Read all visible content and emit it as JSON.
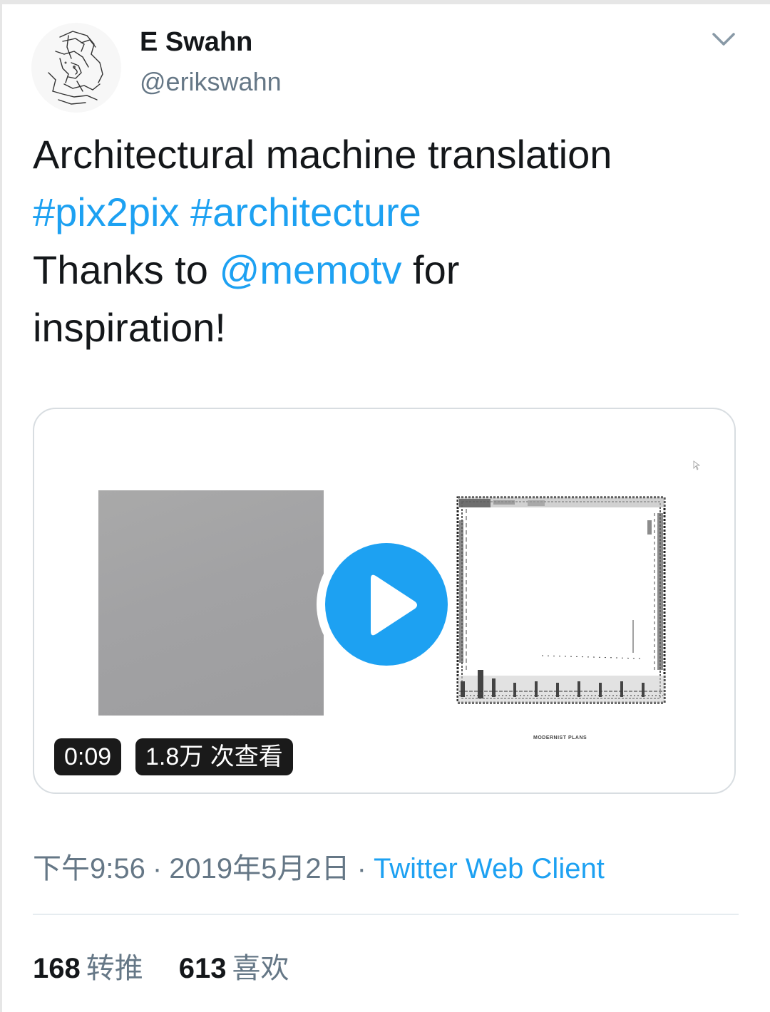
{
  "author": {
    "name": "E Swahn",
    "handle": "@erikswahn"
  },
  "tweet": {
    "line1": "Architectural machine translation",
    "hashtag1": "#pix2pix",
    "hashtag2": "#architecture",
    "thanks_prefix": "Thanks to ",
    "mention": "@memotv",
    "thanks_suffix": " for",
    "line4": "inspiration!"
  },
  "media": {
    "duration": "0:09",
    "views": "1.8万 次查看",
    "plan_caption": "MODERNIST PLANS"
  },
  "meta": {
    "time": "下午9:56",
    "separator": "·",
    "date": "2019年5月2日",
    "client": "Twitter Web Client"
  },
  "stats": {
    "retweets_count": "168",
    "retweets_label": "转推",
    "likes_count": "613",
    "likes_label": "喜欢"
  },
  "colors": {
    "link": "#1da1f2",
    "secondary_text": "#657786",
    "primary_text": "#14171a"
  },
  "icons": [
    "avatar-sketch-icon",
    "chevron-down-icon",
    "play-icon"
  ]
}
